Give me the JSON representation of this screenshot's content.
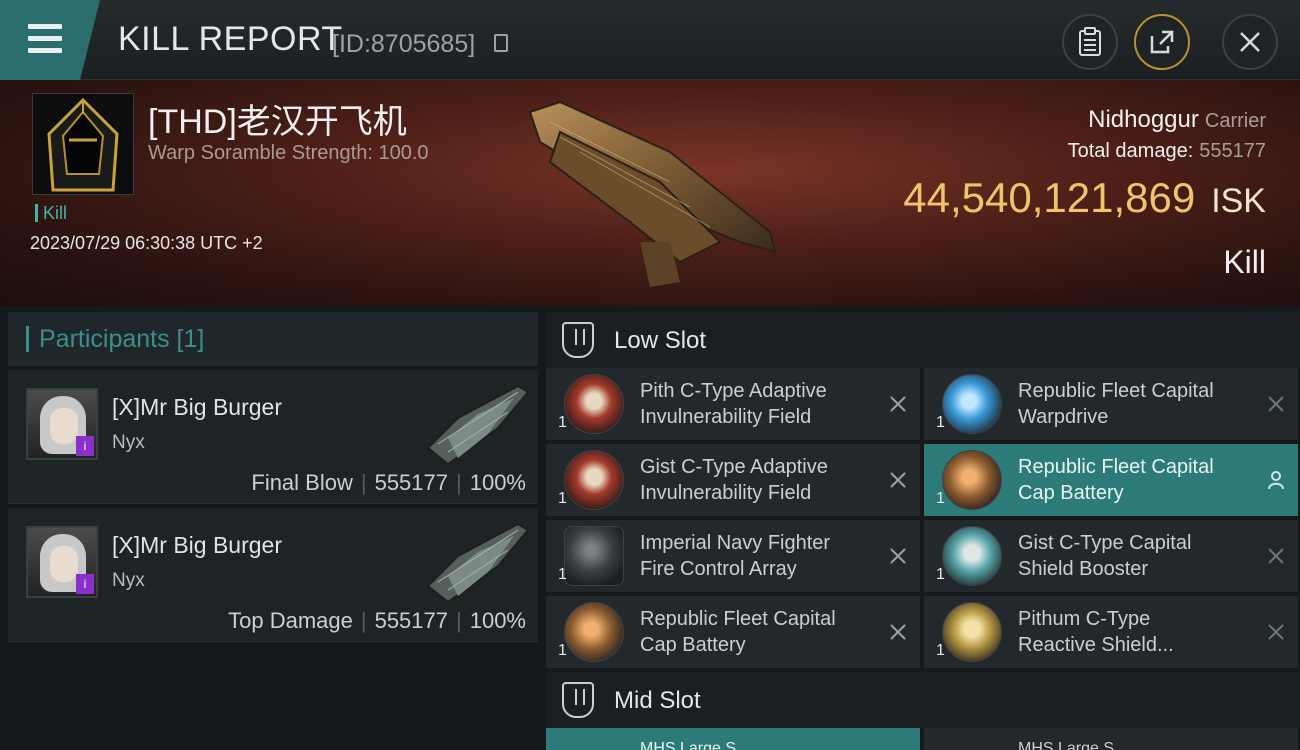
{
  "header": {
    "title": "KILL REPORT",
    "report_id": "[ID:8705685]"
  },
  "victim": {
    "name": "[THD]老汉开飞机",
    "scramble": "Warp Soramble Strength: 100.0",
    "tag": "Kill",
    "timestamp": "2023/07/29 06:30:38 UTC +2",
    "ship_name": "Nidhoggur",
    "ship_class": "Carrier",
    "total_damage_label": "Total damage:",
    "total_damage_value": "555177",
    "isk_value": "44,540,121,869",
    "isk_unit": "ISK",
    "result": "Kill"
  },
  "participants": {
    "heading": "Participants [1]",
    "list": [
      {
        "name": "[X]Mr Big Burger",
        "ship": "Nyx",
        "role": "Final Blow",
        "damage": "555177",
        "percent": "100%",
        "badge": "i"
      },
      {
        "name": "[X]Mr Big Burger",
        "ship": "Nyx",
        "role": "Top Damage",
        "damage": "555177",
        "percent": "100%",
        "badge": "i"
      }
    ]
  },
  "slots": {
    "low": {
      "title": "Low Slot",
      "modules": [
        {
          "qty": "1",
          "line1": "Pith C-Type Adaptive",
          "line2": "Invulnerability Field",
          "icon": "red-shield-module"
        },
        {
          "qty": "1",
          "line1": "Republic Fleet Capital",
          "line2": "Warpdrive",
          "icon": "warpdrive-module"
        },
        {
          "qty": "1",
          "line1": "Gist C-Type Adaptive",
          "line2": "Invulnerability Field",
          "icon": "red-shield-module"
        },
        {
          "qty": "1",
          "line1": "Republic Fleet Capital",
          "line2": "Cap Battery",
          "icon": "cap-battery-module"
        },
        {
          "qty": "1",
          "line1": "Imperial Navy Fighter",
          "line2": "Fire Control Array",
          "icon": "fighter-array-module"
        },
        {
          "qty": "1",
          "line1": "Gist C-Type Capital",
          "line2": "Shield Booster",
          "icon": "shield-booster-module"
        },
        {
          "qty": "1",
          "line1": "Republic Fleet Capital",
          "line2": "Cap Battery",
          "icon": "cap-battery-module"
        },
        {
          "qty": "1",
          "line1": "Pithum C-Type",
          "line2": "Reactive Shield...",
          "icon": "reactive-shield-module"
        }
      ]
    },
    "mid": {
      "title": "Mid Slot",
      "peek": [
        "MHS Large S...",
        "MHS Large S..."
      ]
    }
  }
}
